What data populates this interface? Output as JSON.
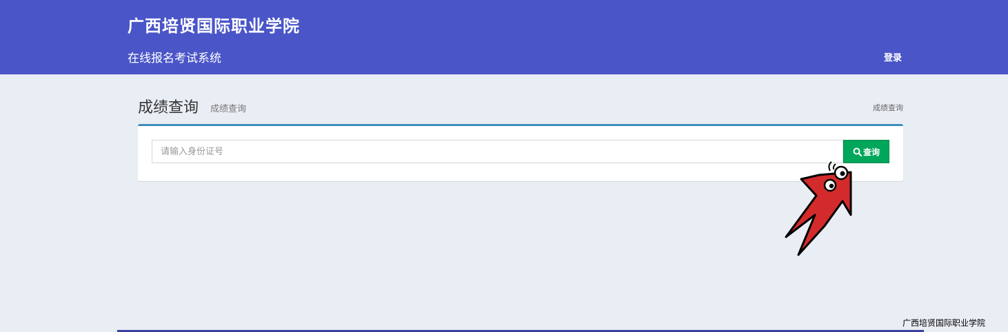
{
  "header": {
    "title": "广西培贤国际职业学院",
    "subtitle": "在线报名考试系统",
    "login_label": "登录"
  },
  "page": {
    "title": "成绩查询",
    "subtitle": "成绩查询",
    "breadcrumb": "成绩查询"
  },
  "search": {
    "placeholder": "请输入身份证号",
    "value": "",
    "button_label": "查询",
    "button_icon": "search-icon"
  },
  "footer": {
    "watermark": "广西培贤国际职业学院"
  },
  "colors": {
    "header_bg": "#4a55c8",
    "page_bg": "#e9edf4",
    "panel_top_border": "#3c8dbc",
    "button_bg": "#00a65a",
    "pointer_arrow": "#d32b2b"
  }
}
